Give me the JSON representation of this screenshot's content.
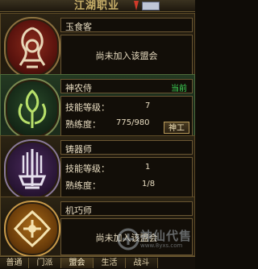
{
  "header": {
    "title": "江湖职业"
  },
  "cards": [
    {
      "name": "玉食客",
      "status": "尚未加入该盟会",
      "emblem": "yushike-emblem"
    },
    {
      "name": "神农侍",
      "badge": "当前",
      "skill_level_label": "技能等级：",
      "skill_level": "7",
      "proficiency_label": "熟练度：",
      "proficiency": "775/980",
      "button": "神工",
      "emblem": "shennongshi-emblem"
    },
    {
      "name": "铸器师",
      "skill_level_label": "技能等级：",
      "skill_level": "1",
      "proficiency_label": "熟练度：",
      "proficiency": "1/8",
      "emblem": "zhuqishi-emblem"
    },
    {
      "name": "机巧师",
      "status": "尚未加入该盟会",
      "emblem": "jiqiaoshi-emblem"
    }
  ],
  "tabs": [
    "普通",
    "门派",
    "盟会",
    "生活",
    "战斗"
  ],
  "watermark": {
    "text": "神仙代售",
    "url": "www.8yxs.com"
  },
  "colors": {
    "accent_green": "#3fdc5a",
    "gold_border": "#8c7240",
    "text": "#e8dcc0"
  }
}
